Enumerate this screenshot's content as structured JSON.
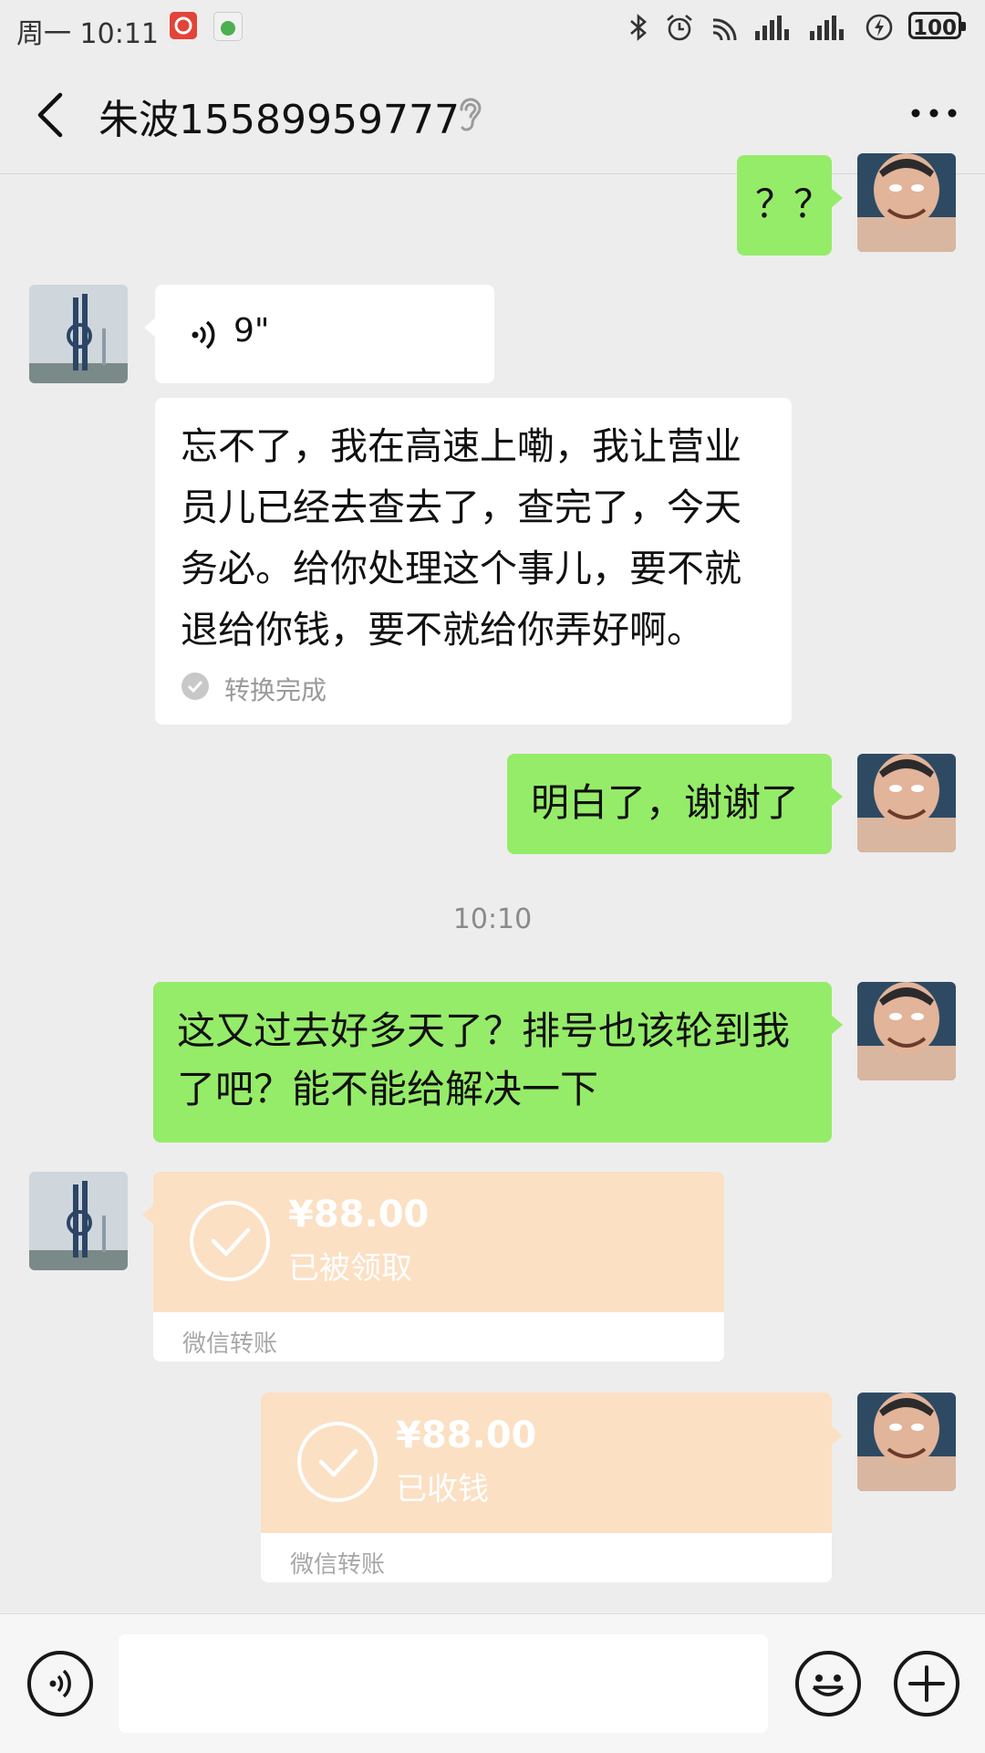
{
  "status_bar": {
    "day_time": "周一  10:11",
    "battery": "100"
  },
  "header": {
    "title": "朱波15589959777",
    "back_icon": "chevron-left-icon",
    "ear_icon": "ear-icon",
    "more_icon": "more-dots-icon"
  },
  "messages": {
    "m1_out_text": "？？",
    "m2_voice_duration": "9\"",
    "m3_transcript_text": "忘不了，我在高速上嘞，我让营业员儿已经去查去了，查完了，今天务必。给你处理这个事儿，要不就退给你钱，要不就给你弄好啊。",
    "m3_transcript_status": "转换完成",
    "m4_out_text": "明白了，谢谢了",
    "timestamp": "10:10",
    "m5_out_text": "这又过去好多天了？排号也该轮到我了吧？能不能给解决一下",
    "t1_amount": "¥88.00",
    "t1_status": "已被领取",
    "t1_label": "微信转账",
    "t2_amount": "¥88.00",
    "t2_status": "已收钱",
    "t2_label": "微信转账"
  },
  "input_bar": {
    "voice_icon": "voice-icon",
    "emoji_icon": "emoji-icon",
    "plus_icon": "plus-icon"
  },
  "colors": {
    "outgoing_bubble": "#95ec69",
    "incoming_bubble": "#ffffff",
    "transfer_card": "#fbe0c4",
    "background": "#ededed"
  }
}
